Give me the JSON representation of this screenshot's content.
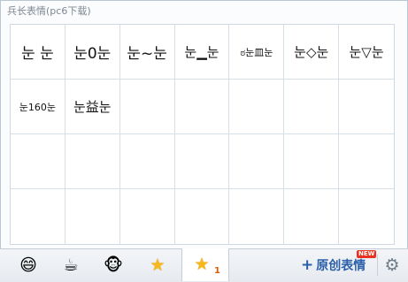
{
  "panel": {
    "title": "兵长表情(pc6下载)"
  },
  "emoticons": [
    {
      "text": "눈 눈"
    },
    {
      "text": "눈0눈"
    },
    {
      "text": "눈~눈"
    },
    {
      "text": "눈▁눈"
    },
    {
      "text": "ಠ눈皿눈"
    },
    {
      "text": "눈◇눈"
    },
    {
      "text": "눈▽눈"
    },
    {
      "text": "눈160눈"
    },
    {
      "text": "눈益눈"
    }
  ],
  "tabs": [
    {
      "name": "smiley-face-icon",
      "glyph": "😄"
    },
    {
      "name": "coffee-cup-icon",
      "glyph": "☕"
    },
    {
      "name": "monkey-face-icon",
      "glyph": "🐵"
    },
    {
      "name": "star-icon",
      "glyph": "★"
    },
    {
      "name": "star-icon",
      "glyph": "★",
      "badge": "1"
    }
  ],
  "toolbar": {
    "create_plus": "+",
    "create_label": "原创表情",
    "new_badge": "NEW",
    "settings_glyph": "⚙"
  },
  "colors": {
    "accent": "#2b5fa8",
    "star": "#f6b81a",
    "badge": "#e05a00",
    "new_badge": "#e8321f"
  }
}
